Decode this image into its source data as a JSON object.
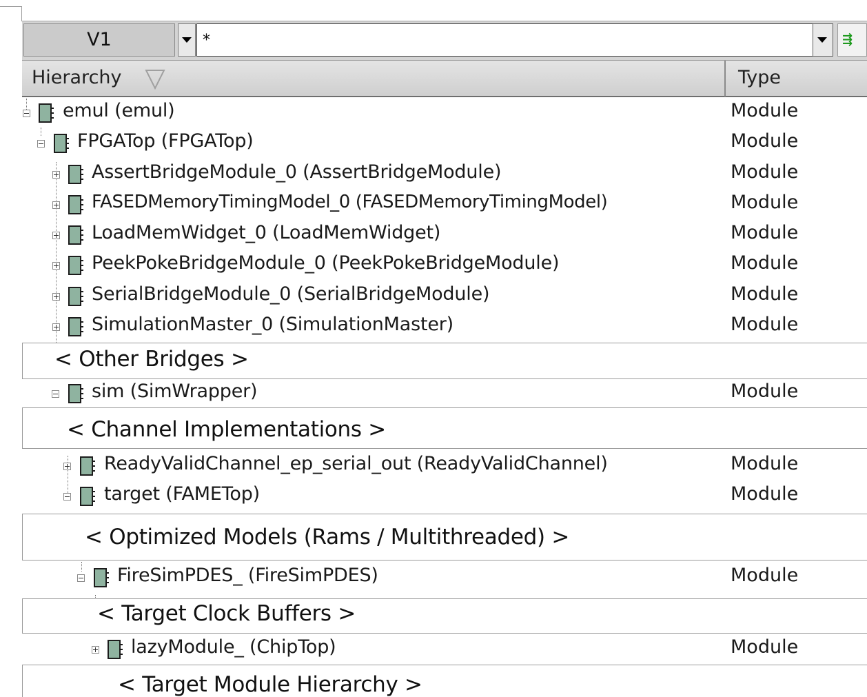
{
  "toolbar": {
    "scope_label": "V1",
    "filter_value": "*",
    "apply_icon": "filter-apply-icon"
  },
  "header": {
    "hierarchy_label": "Hierarchy",
    "type_label": "Type",
    "sort_icon": "sort-down-triangle-icon"
  },
  "tree": {
    "emul": {
      "label": "emul (emul)",
      "type": "Module"
    },
    "fpgatop": {
      "label": "FPGATop (FPGATop)",
      "type": "Module"
    },
    "assert": {
      "label": "AssertBridgeModule_0 (AssertBridgeModule)",
      "type": "Module"
    },
    "fased": {
      "label": "FASEDMemoryTimingModel_0 (FASEDMemoryTimingModel)",
      "type": "Module"
    },
    "loadmem": {
      "label": "LoadMemWidget_0 (LoadMemWidget)",
      "type": "Module"
    },
    "peekpoke": {
      "label": "PeekPokeBridgeModule_0 (PeekPokeBridgeModule)",
      "type": "Module"
    },
    "serial": {
      "label": "SerialBridgeModule_0 (SerialBridgeModule)",
      "type": "Module"
    },
    "simmaster": {
      "label": "SimulationMaster_0 (SimulationMaster)",
      "type": "Module"
    },
    "sep_bridges": "< Other Bridges >",
    "sim": {
      "label": "sim (SimWrapper)",
      "type": "Module"
    },
    "sep_channels": "< Channel Implementations >",
    "rvchannel": {
      "label": "ReadyValidChannel_ep_serial_out (ReadyValidChannel)",
      "type": "Module"
    },
    "target": {
      "label": "target (FAMETop)",
      "type": "Module"
    },
    "sep_optimized": "< Optimized Models (Rams / Multithreaded) >",
    "firesim": {
      "label": "FireSimPDES_ (FireSimPDES)",
      "type": "Module"
    },
    "sep_clock": "< Target Clock Buffers >",
    "lazy": {
      "label": "lazyModule_ (ChipTop)",
      "type": "Module"
    },
    "sep_hierarchy": "< Target Module Hierarchy >"
  },
  "colors": {
    "module_icon_fill": "#8fb3a0",
    "module_icon_border": "#1c1c1c",
    "apply_icon_color": "#1e9a1e"
  }
}
